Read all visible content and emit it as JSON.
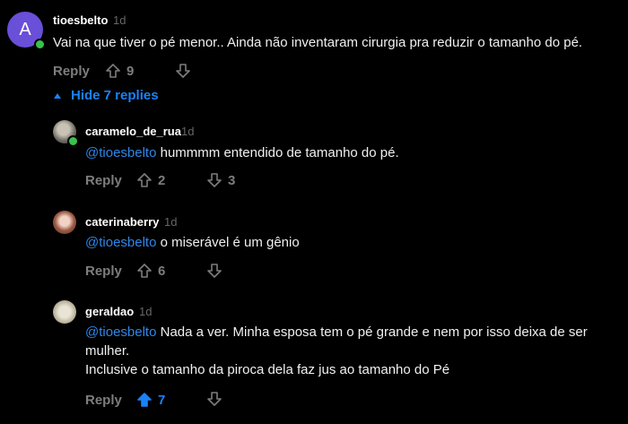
{
  "main_comment": {
    "avatar_letter": "A",
    "username": "tioesbelto",
    "time": "1d",
    "text": "Vai na que tiver o pé menor.. Ainda não inventaram cirurgia pra reduzir o tamanho do pé.",
    "reply_label": "Reply",
    "upvotes": "9",
    "downvotes": ""
  },
  "hide_replies_label": "Hide 7 replies",
  "replies": [
    {
      "username": "caramelo_de_rua",
      "time": "1d",
      "mention": "@tioesbelto",
      "text": "hummmm entendido de tamanho do pé.",
      "reply_label": "Reply",
      "upvotes": "2",
      "downvotes": "3"
    },
    {
      "username": "caterinaberry",
      "time": "1d",
      "mention": "@tioesbelto",
      "text": "o miserável é um gênio",
      "reply_label": "Reply",
      "upvotes": "6",
      "downvotes": ""
    },
    {
      "username": "geraldao",
      "time": "1d",
      "mention": "@tioesbelto",
      "text_line1": "Nada a ver. Minha esposa tem o pé grande e nem por isso deixa de ser",
      "text_line2": "mulher.",
      "text_line3": "Inclusive o tamanho da piroca dela faz jus ao tamanho do Pé",
      "reply_label": "Reply",
      "upvotes": "7",
      "downvotes": ""
    }
  ],
  "colors": {
    "accent": "#1a82f7",
    "mention": "#2f86e8",
    "online": "#39c24a",
    "avatar_bg": "#6a4fd8"
  }
}
